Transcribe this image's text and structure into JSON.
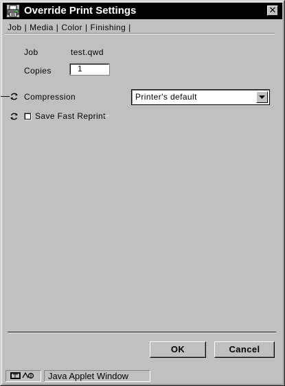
{
  "window": {
    "title": "Override Print Settings",
    "close_glyph": "✕"
  },
  "tabs": [
    {
      "label": "Job"
    },
    {
      "label": "Media"
    },
    {
      "label": "Color"
    },
    {
      "label": "Finishing"
    }
  ],
  "tab_separator": "|",
  "form": {
    "job_label": "Job",
    "job_value": "test.qwd",
    "copies_label": "Copies",
    "copies_value": "1",
    "compression_label": "Compression",
    "compression_value": "Printer's default",
    "save_fast_reprint_label": "Save Fast Reprint",
    "save_fast_reprint_checked": false
  },
  "buttons": {
    "ok_label": "OK",
    "cancel_label": "Cancel"
  },
  "status": {
    "text": "Java Applet Window",
    "icon": "java-applet-icon"
  },
  "icons": {
    "title": "printer-icon",
    "refresh": "refresh-icon",
    "dropdown": "triangle-down-icon"
  },
  "colors": {
    "face": "#c0c0c0",
    "titlebar": "#000000",
    "title_text": "#ffffff"
  }
}
